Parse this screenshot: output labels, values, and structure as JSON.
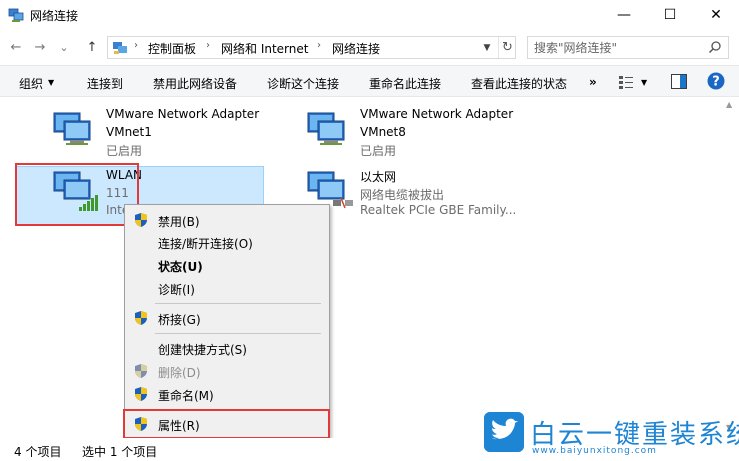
{
  "window": {
    "title": "网络连接",
    "minimize_glyph": "—",
    "maximize_glyph": "☐",
    "close_glyph": "✕"
  },
  "nav": {
    "back_glyph": "←",
    "forward_glyph": "→",
    "recent_glyph": "⌄",
    "up_glyph": "↑",
    "breadcrumbs": [
      "控制面板",
      "网络和 Internet",
      "网络连接"
    ],
    "separator_glyph": "›",
    "search_placeholder": "搜索\"网络连接\""
  },
  "toolbar": {
    "organize": "组织",
    "items": [
      "连接到",
      "禁用此网络设备",
      "诊断这个连接",
      "重命名此连接",
      "查看此连接的状态"
    ],
    "more": "»"
  },
  "adapters": [
    {
      "name": "VMware Network Adapter",
      "sub": "VMnet1",
      "status": "已启用"
    },
    {
      "name": "VMware Network Adapter",
      "sub": "VMnet8",
      "status": "已启用"
    },
    {
      "name": "WLAN",
      "sub": "111",
      "status": "Inte"
    },
    {
      "name": "以太网",
      "sub": "网络电缆被拔出",
      "status": "Realtek PCIe GBE Family..."
    }
  ],
  "context_menu": {
    "items": [
      {
        "label": "禁用(B)",
        "shield": true,
        "style": "normal"
      },
      {
        "label": "连接/断开连接(O)",
        "shield": false,
        "style": "normal"
      },
      {
        "label": "状态(U)",
        "shield": false,
        "style": "bold"
      },
      {
        "label": "诊断(I)",
        "shield": false,
        "style": "normal"
      },
      {
        "label": "桥接(G)",
        "shield": true,
        "style": "normal"
      },
      {
        "label": "创建快捷方式(S)",
        "shield": false,
        "style": "normal"
      },
      {
        "label": "删除(D)",
        "shield": true,
        "style": "disabled"
      },
      {
        "label": "重命名(M)",
        "shield": true,
        "style": "normal"
      },
      {
        "label": "属性(R)",
        "shield": true,
        "style": "normal"
      }
    ]
  },
  "status": {
    "count": "4 个项目",
    "selected": "选中 1 个项目"
  },
  "watermark": {
    "cn": "白云一键重装系统",
    "en": "www.baiyunxitong.com"
  },
  "colors": {
    "accent": "#0078d7",
    "selection": "#cce8ff",
    "highlight_box": "#e03a3a",
    "watermark": "#1e84d4"
  },
  "icons": {
    "adapter": "network-adapter-icon",
    "wifi_signal": "wifi-signal-icon",
    "cable_unplugged": "cable-disconnected-icon",
    "shield": "uac-shield-icon",
    "search": "search-icon",
    "help": "help-icon",
    "view": "change-view-icon",
    "preview": "preview-pane-icon"
  }
}
